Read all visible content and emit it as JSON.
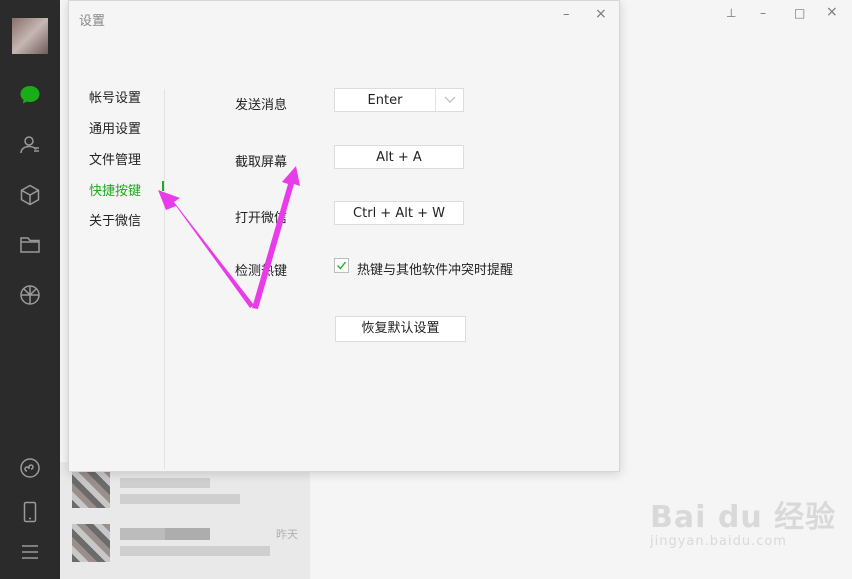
{
  "dialog": {
    "title": "设置",
    "minimize": "–",
    "close": "×"
  },
  "window_controls": {
    "pin": "⊥",
    "minimize": "–",
    "maximize": "□",
    "close": "×"
  },
  "nav": {
    "items": [
      {
        "label": "帐号设置"
      },
      {
        "label": "通用设置"
      },
      {
        "label": "文件管理"
      },
      {
        "label": "快捷按键",
        "active": true
      },
      {
        "label": "关于微信"
      }
    ]
  },
  "shortcuts": {
    "send_message": {
      "label": "发送消息",
      "value": "Enter"
    },
    "screenshot": {
      "label": "截取屏幕",
      "value": "Alt + A"
    },
    "open_wechat": {
      "label": "打开微信",
      "value": "Ctrl + Alt + W"
    },
    "detect_hotkey": {
      "label": "检测热键",
      "checkbox_label": "热键与其他软件冲突时提醒",
      "checked": true
    },
    "reset_button": "恢复默认设置"
  },
  "chat_list": {
    "times": [
      "昨天"
    ]
  },
  "colors": {
    "accent_green": "#1aad19",
    "sidebar_bg": "#2b2b2b",
    "arrow": "#e83ce8"
  },
  "icons": [
    "chat-icon",
    "contacts-icon",
    "collection-icon",
    "folder-icon",
    "moments-icon",
    "mini-program-icon",
    "phone-icon",
    "menu-icon"
  ],
  "watermark": {
    "brand": "Bai du 经验",
    "sub": "jingyan.baidu.com"
  }
}
